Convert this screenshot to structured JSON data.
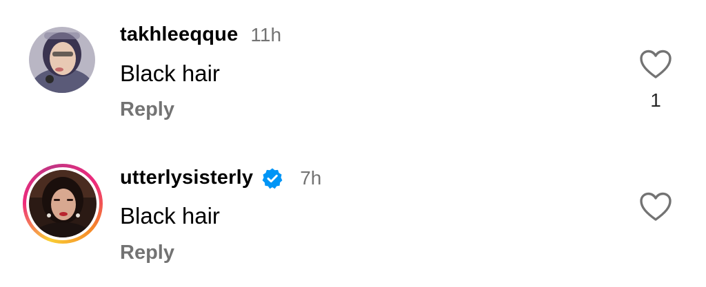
{
  "comments": [
    {
      "username": "takhleeqque",
      "verified": false,
      "has_story_ring": false,
      "timestamp": "11h",
      "text": "Black hair",
      "reply_label": "Reply",
      "like_count": "1",
      "like_icon": "heart-outline-icon"
    },
    {
      "username": "utterlysisterly",
      "verified": true,
      "verified_icon": "verified-badge-icon",
      "has_story_ring": true,
      "timestamp": "7h",
      "text": "Black hair",
      "reply_label": "Reply",
      "like_count": "",
      "like_icon": "heart-outline-icon"
    }
  ],
  "colors": {
    "secondary_text": "#737373",
    "verified_blue": "#0095f6",
    "story_ring_start": "#f9ce34",
    "story_ring_mid": "#ee2a7b",
    "story_ring_end": "#c13584"
  }
}
